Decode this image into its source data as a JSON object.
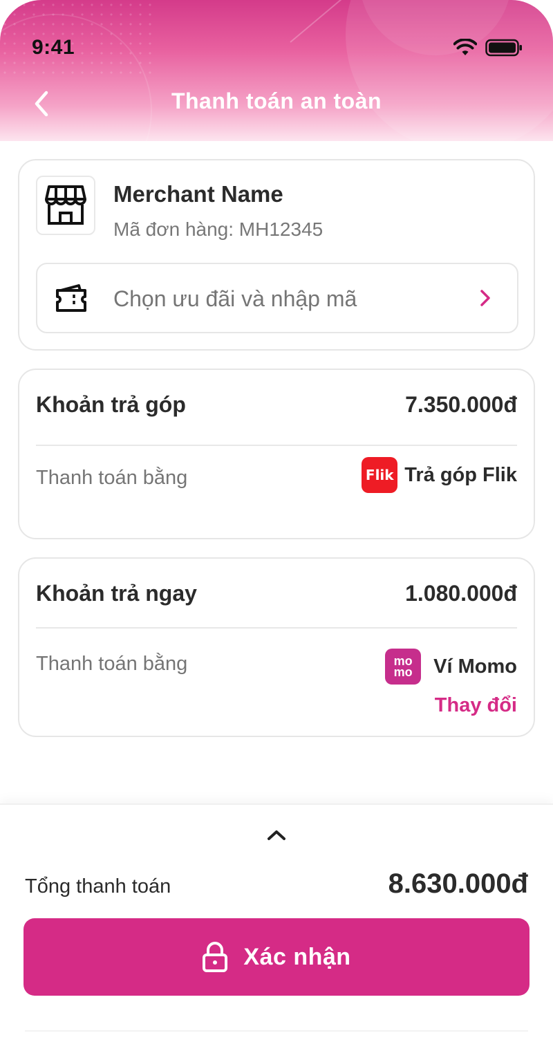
{
  "status_bar": {
    "time": "9:41"
  },
  "header": {
    "title": "Thanh toán an toàn"
  },
  "merchant": {
    "name": "Merchant Name",
    "order_id": "Mã đơn hàng: MH12345",
    "voucher_placeholder": "Chọn ưu đãi và nhập mã"
  },
  "installment": {
    "title": "Khoản trả góp",
    "amount": "7.350.000đ",
    "pay_label": "Thanh toán bằng",
    "method_name": "Trả góp Flik",
    "method_logo_text": "Flik"
  },
  "pay_now": {
    "title": "Khoản trả ngay",
    "amount": "1.080.000đ",
    "pay_label": "Thanh toán bằng",
    "method_name": "Ví Momo",
    "method_logo_top": "mo",
    "method_logo_bottom": "mo",
    "change_label": "Thay đổi"
  },
  "footer": {
    "total_label": "Tổng thanh toán",
    "total_amount": "8.630.000đ",
    "confirm_label": "Xác nhận"
  },
  "colors": {
    "accent": "#d52b86",
    "header_top": "#d43b8a",
    "flik_red": "#ee1c25",
    "momo_pink": "#c62e8c"
  },
  "icons": [
    "back-chevron-icon",
    "wifi-icon",
    "battery-icon",
    "store-icon",
    "voucher-icon",
    "chevron-right-icon",
    "chevron-up-icon",
    "lock-icon"
  ]
}
